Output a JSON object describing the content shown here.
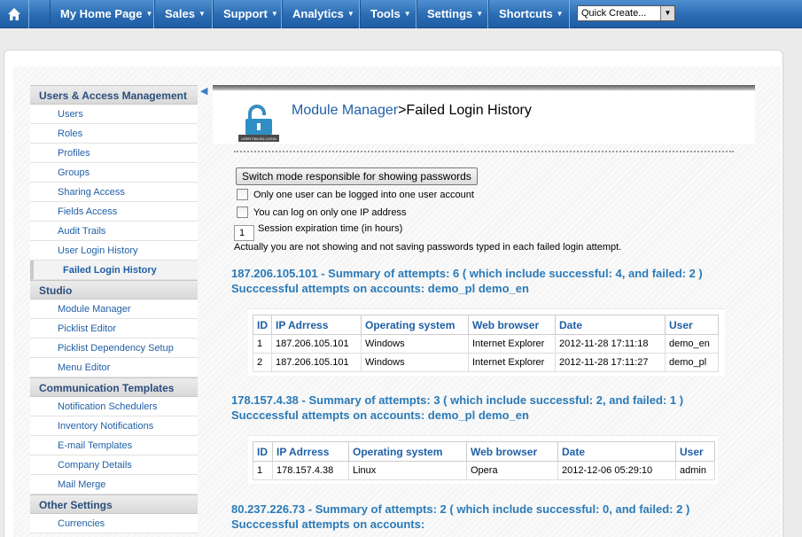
{
  "nav": {
    "home_icon": "home-icon",
    "items": [
      {
        "label": "My Home Page"
      },
      {
        "label": "Sales"
      },
      {
        "label": "Support"
      },
      {
        "label": "Analytics"
      },
      {
        "label": "Tools"
      },
      {
        "label": "Settings"
      },
      {
        "label": "Shortcuts"
      }
    ],
    "quick_create": "Quick Create..."
  },
  "sidebar": {
    "sections": [
      {
        "title": "Users & Access Management",
        "items": [
          "Users",
          "Roles",
          "Profiles",
          "Groups",
          "Sharing Access",
          "Fields Access",
          "Audit Trails",
          "User Login History",
          "Failed Login History"
        ]
      },
      {
        "title": "Studio",
        "items": [
          "Module Manager",
          "Picklist Editor",
          "Picklist Dependency Setup",
          "Menu Editor"
        ]
      },
      {
        "title": "Communication Templates",
        "items": [
          "Notification Schedulers",
          "Inventory Notifications",
          "E-mail Templates",
          "Company Details",
          "Mail Merge"
        ]
      },
      {
        "title": "Other Settings",
        "items": [
          "Currencies"
        ]
      }
    ],
    "active_item": "Failed Login History"
  },
  "header": {
    "icon_caption": "USER FAILED LOGIN",
    "breadcrumb_link": "Module Manager",
    "title": ">Failed Login History"
  },
  "controls": {
    "switch_button": "Switch mode responsible for showing passwords",
    "option_one_user": "Only one user can be logged into one user account",
    "option_one_ip": "You can log on only one IP address",
    "session_value": "1",
    "session_label": "Session expiration time (in hours)",
    "notice": "Actually you are not showing and not saving passwords typed in each failed login attempt."
  },
  "columns": [
    "ID",
    "IP Adrress",
    "Operating system",
    "Web browser",
    "Date",
    "User"
  ],
  "groups": [
    {
      "ip": "187.206.105.101",
      "summary": " - Summary of attempts: 6 ( which include successful: 4, and failed: 2 )",
      "accounts": "Succcessful attempts on accounts: demo_pl demo_en",
      "rows": [
        [
          "1",
          "187.206.105.101",
          "Windows",
          "Internet Explorer",
          "2012-11-28 17:11:18",
          "demo_en"
        ],
        [
          "2",
          "187.206.105.101",
          "Windows",
          "Internet Explorer",
          "2012-11-28 17:11:27",
          "demo_pl"
        ]
      ]
    },
    {
      "ip": "178.157.4.38",
      "summary": " - Summary of attempts: 3 ( which include successful: 2, and failed: 1 )",
      "accounts": "Succcessful attempts on accounts: demo_pl demo_en",
      "rows": [
        [
          "1",
          "178.157.4.38",
          "Linux",
          "Opera",
          "2012-12-06 05:29:10",
          "admin"
        ]
      ]
    },
    {
      "ip": "80.237.226.73",
      "summary": " - Summary of attempts: 2 ( which include successful: 0, and failed: 2 )",
      "accounts": "Succcessful attempts on accounts:",
      "rows": []
    }
  ]
}
